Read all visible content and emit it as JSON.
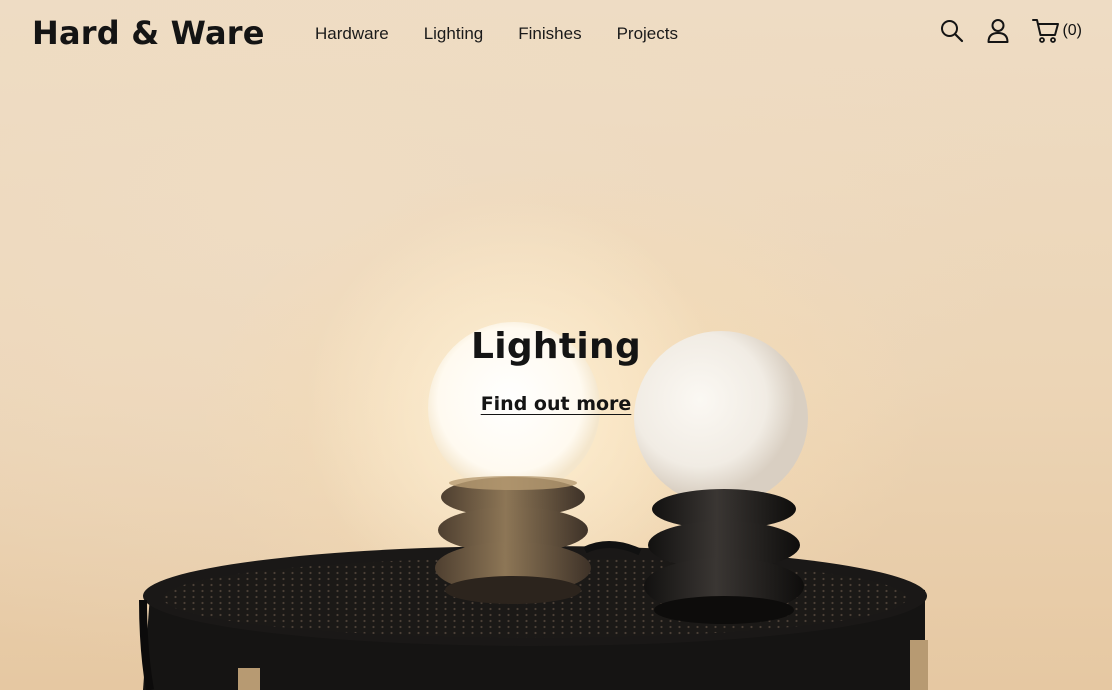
{
  "brand": {
    "name": "Hard & Ware"
  },
  "nav": {
    "items": [
      {
        "label": "Hardware"
      },
      {
        "label": "Lighting"
      },
      {
        "label": "Finishes"
      },
      {
        "label": "Projects"
      }
    ]
  },
  "header_icons": {
    "search": "search-icon",
    "account": "user-icon",
    "cart": "cart-icon",
    "cart_count": "(0)"
  },
  "hero": {
    "title": "Lighting",
    "cta_label": "Find out more",
    "image": "two-globe-table-lamps-on-round-black-tray-table"
  },
  "colors": {
    "text": "#141414",
    "wall": "#eedcc4",
    "table": "#141414",
    "lamp_base_bronze": "#6e5a44",
    "lamp_base_black": "#1c1a19"
  }
}
